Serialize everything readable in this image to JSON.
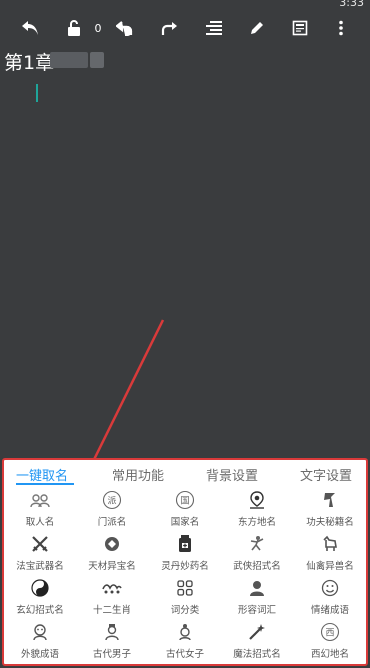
{
  "status": {
    "time": "3:33"
  },
  "toolbar": {
    "lock_count": "0"
  },
  "editor": {
    "chapter_title": "第1章"
  },
  "panel": {
    "tabs": [
      "一键取名",
      "常用功能",
      "背景设置",
      "文字设置"
    ],
    "active_tab": 0,
    "items": [
      {
        "label": "取人名",
        "icon": "people-icon"
      },
      {
        "label": "门派名",
        "icon": "sect-badge-icon",
        "glyph": "派"
      },
      {
        "label": "国家名",
        "icon": "country-badge-icon",
        "glyph": "国"
      },
      {
        "label": "东方地名",
        "icon": "location-pin-icon"
      },
      {
        "label": "功夫秘籍名",
        "icon": "kungfu-icon"
      },
      {
        "label": "法宝武器名",
        "icon": "crossed-swords-icon"
      },
      {
        "label": "天材异宝名",
        "icon": "treasure-icon"
      },
      {
        "label": "灵丹妙药名",
        "icon": "medicine-bottle-icon"
      },
      {
        "label": "武侠招式名",
        "icon": "martial-pose-icon"
      },
      {
        "label": "仙禽异兽名",
        "icon": "beast-icon"
      },
      {
        "label": "玄幻招式名",
        "icon": "yin-yang-icon"
      },
      {
        "label": "十二生肖",
        "icon": "zodiac-icon"
      },
      {
        "label": "词分类",
        "icon": "grid-icon"
      },
      {
        "label": "形容词汇",
        "icon": "person-portrait-icon"
      },
      {
        "label": "情绪成语",
        "icon": "smiley-icon"
      },
      {
        "label": "外貌成语",
        "icon": "face-icon"
      },
      {
        "label": "古代男子",
        "icon": "male-figure-icon"
      },
      {
        "label": "古代女子",
        "icon": "female-figure-icon"
      },
      {
        "label": "魔法招式名",
        "icon": "magic-wand-icon"
      },
      {
        "label": "西幻地名",
        "icon": "west-badge-icon",
        "glyph": "西"
      }
    ]
  }
}
